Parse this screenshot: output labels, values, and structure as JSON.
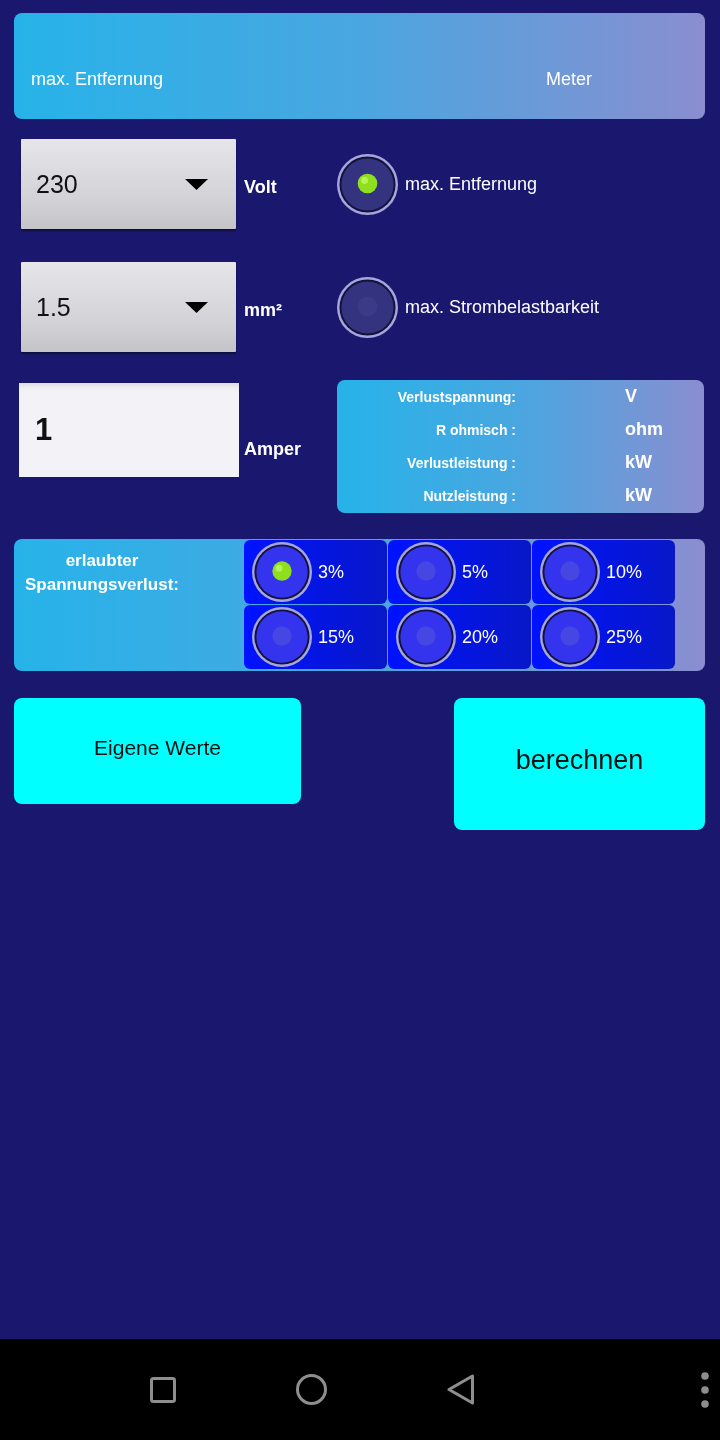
{
  "header": {
    "label": "max. Entfernung",
    "unit": "Meter"
  },
  "inputs": [
    {
      "kind": "dropdown",
      "value": "230",
      "unit": "Volt"
    },
    {
      "kind": "dropdown",
      "value": "1.5",
      "unit": "mm²"
    },
    {
      "kind": "text",
      "value": "1",
      "unit": "Amper"
    }
  ],
  "mode_options": [
    {
      "label": "max. Entfernung",
      "selected": true
    },
    {
      "label": "max. Strombelastbarkeit",
      "selected": false
    }
  ],
  "results": [
    {
      "label": "Verlustspannung:",
      "unit": "V"
    },
    {
      "label": "R ohmisch :",
      "unit": "ohm"
    },
    {
      "label": "Verlustleistung :",
      "unit": "kW"
    },
    {
      "label": "Nutzleistung :",
      "unit": "kW"
    }
  ],
  "voltage_loss": {
    "label": "erlaubter Spannungsverlust:",
    "options": [
      {
        "label": "3%",
        "selected": true
      },
      {
        "label": "5%",
        "selected": false
      },
      {
        "label": "10%",
        "selected": false
      },
      {
        "label": "15%",
        "selected": false
      },
      {
        "label": "20%",
        "selected": false
      },
      {
        "label": "25%",
        "selected": false
      }
    ]
  },
  "buttons": [
    {
      "label": "Eigene Werte",
      "kind": "small"
    },
    {
      "label": "berechnen",
      "kind": "large"
    }
  ]
}
